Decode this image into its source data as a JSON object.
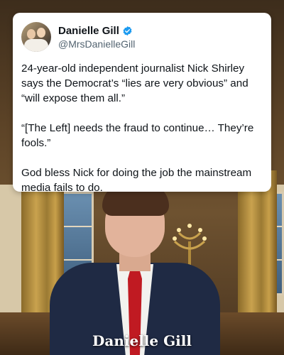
{
  "tweet": {
    "author_name": "Danielle Gill",
    "author_handle": "@MrsDanielleGill",
    "verified_icon": "verified-badge-icon",
    "verified_color": "#1d9bf0",
    "paragraphs": [
      "24-year-old independent journalist Nick Shirley says the Democrat’s “lies are very obvious” and “will expose them all.”",
      "“[The Left] needs the fraud to continue… They’re fools.”",
      "God bless Nick for doing the job the mainstream media fails to do."
    ]
  },
  "watermark": {
    "text": "Danielle Gill"
  },
  "colors": {
    "card_background": "#ffffff",
    "tie": "#c01a22",
    "suit": "#1f2a44"
  }
}
